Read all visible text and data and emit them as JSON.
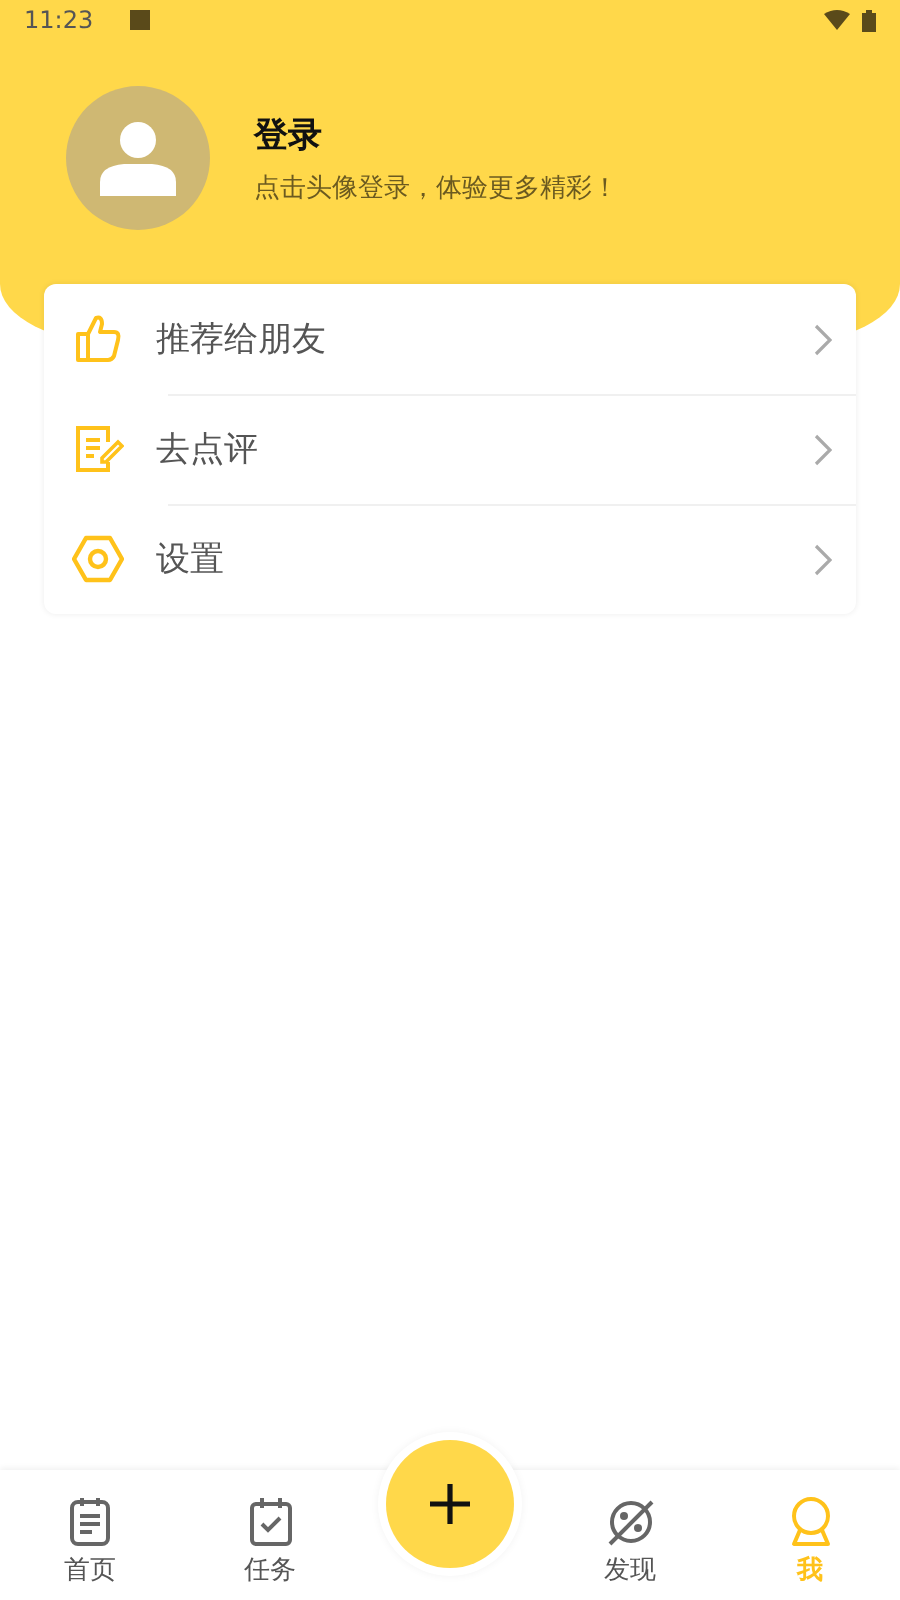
{
  "status_bar": {
    "time": "11:23"
  },
  "profile": {
    "title": "登录",
    "subtitle": "点击头像登录，体验更多精彩！"
  },
  "menu": [
    {
      "label": "推荐给朋友"
    },
    {
      "label": "去点评"
    },
    {
      "label": "设置"
    }
  ],
  "bottom_nav": [
    {
      "label": "首页",
      "selected": false
    },
    {
      "label": "任务",
      "selected": false
    },
    {
      "label": "发现",
      "selected": false
    },
    {
      "label": "我",
      "selected": true
    }
  ]
}
